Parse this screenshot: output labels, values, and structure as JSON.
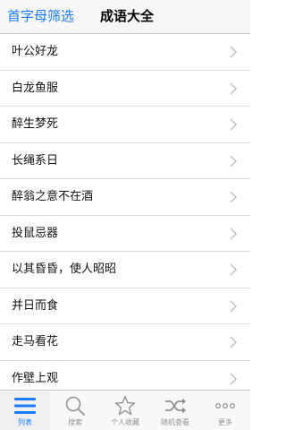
{
  "header": {
    "filter_label": "首字母筛选",
    "title": "成语大全"
  },
  "list": {
    "items": [
      {
        "label": "叶公好龙"
      },
      {
        "label": "白龙鱼服"
      },
      {
        "label": "醉生梦死"
      },
      {
        "label": "长绳系日"
      },
      {
        "label": "醉翁之意不在酒"
      },
      {
        "label": "投鼠忌器"
      },
      {
        "label": "以其昏昏，使人昭昭"
      },
      {
        "label": "并日而食"
      },
      {
        "label": "走马看花"
      },
      {
        "label": "作壁上观"
      }
    ]
  },
  "tabbar": {
    "tabs": [
      {
        "label": "列表",
        "icon": "list-icon",
        "active": true
      },
      {
        "label": "搜索",
        "icon": "search-icon",
        "active": false
      },
      {
        "label": "个人收藏",
        "icon": "star-icon",
        "active": false
      },
      {
        "label": "随机查看",
        "icon": "shuffle-icon",
        "active": false
      },
      {
        "label": "更多",
        "icon": "more-icon",
        "active": false
      }
    ]
  },
  "colors": {
    "accent": "#1a7cf5",
    "inactive": "#929292"
  }
}
